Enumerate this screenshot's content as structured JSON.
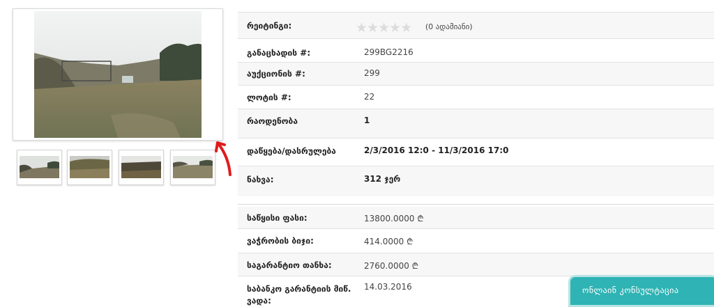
{
  "gallery": {
    "main_image": "main-photo",
    "thumbnails": [
      "thumbnail-1",
      "thumbnail-2",
      "thumbnail-3",
      "thumbnail-4"
    ],
    "arrow_color": "#e01b1b"
  },
  "details": {
    "rating": {
      "label": "რეიტინგი:",
      "votes": "(0 ადამიანი)",
      "stars": 5,
      "filled": 0
    },
    "rows1": [
      {
        "label": "განაცხადის #:",
        "value": "299BG2216"
      },
      {
        "label": "აუქციონის #:",
        "value": "299"
      },
      {
        "label": "ლოტის #:",
        "value": "22"
      },
      {
        "label": "რაოდენობა",
        "value": "1"
      },
      {
        "label": "დაწყება/დასრულება",
        "value": "2/3/2016 12:0 - 11/3/2016 17:0"
      },
      {
        "label": "ნახვა:",
        "value": "312 ჯერ"
      }
    ],
    "rows2": [
      {
        "label": "საწყისი ფასი:",
        "value": "13800.0000 ₾"
      },
      {
        "label": "ვაჭრობის ბიჯი:",
        "value": "414.0000 ₾"
      },
      {
        "label": "საგარანტიო თანხა:",
        "value": "2760.0000 ₾"
      },
      {
        "label": "საბანკო გარანტიის მიწ. ვადა:",
        "value": "14.03.2016"
      }
    ]
  },
  "consult": {
    "label": "ონლაინ კონსულტაცია",
    "color": "#2fb3b4"
  }
}
